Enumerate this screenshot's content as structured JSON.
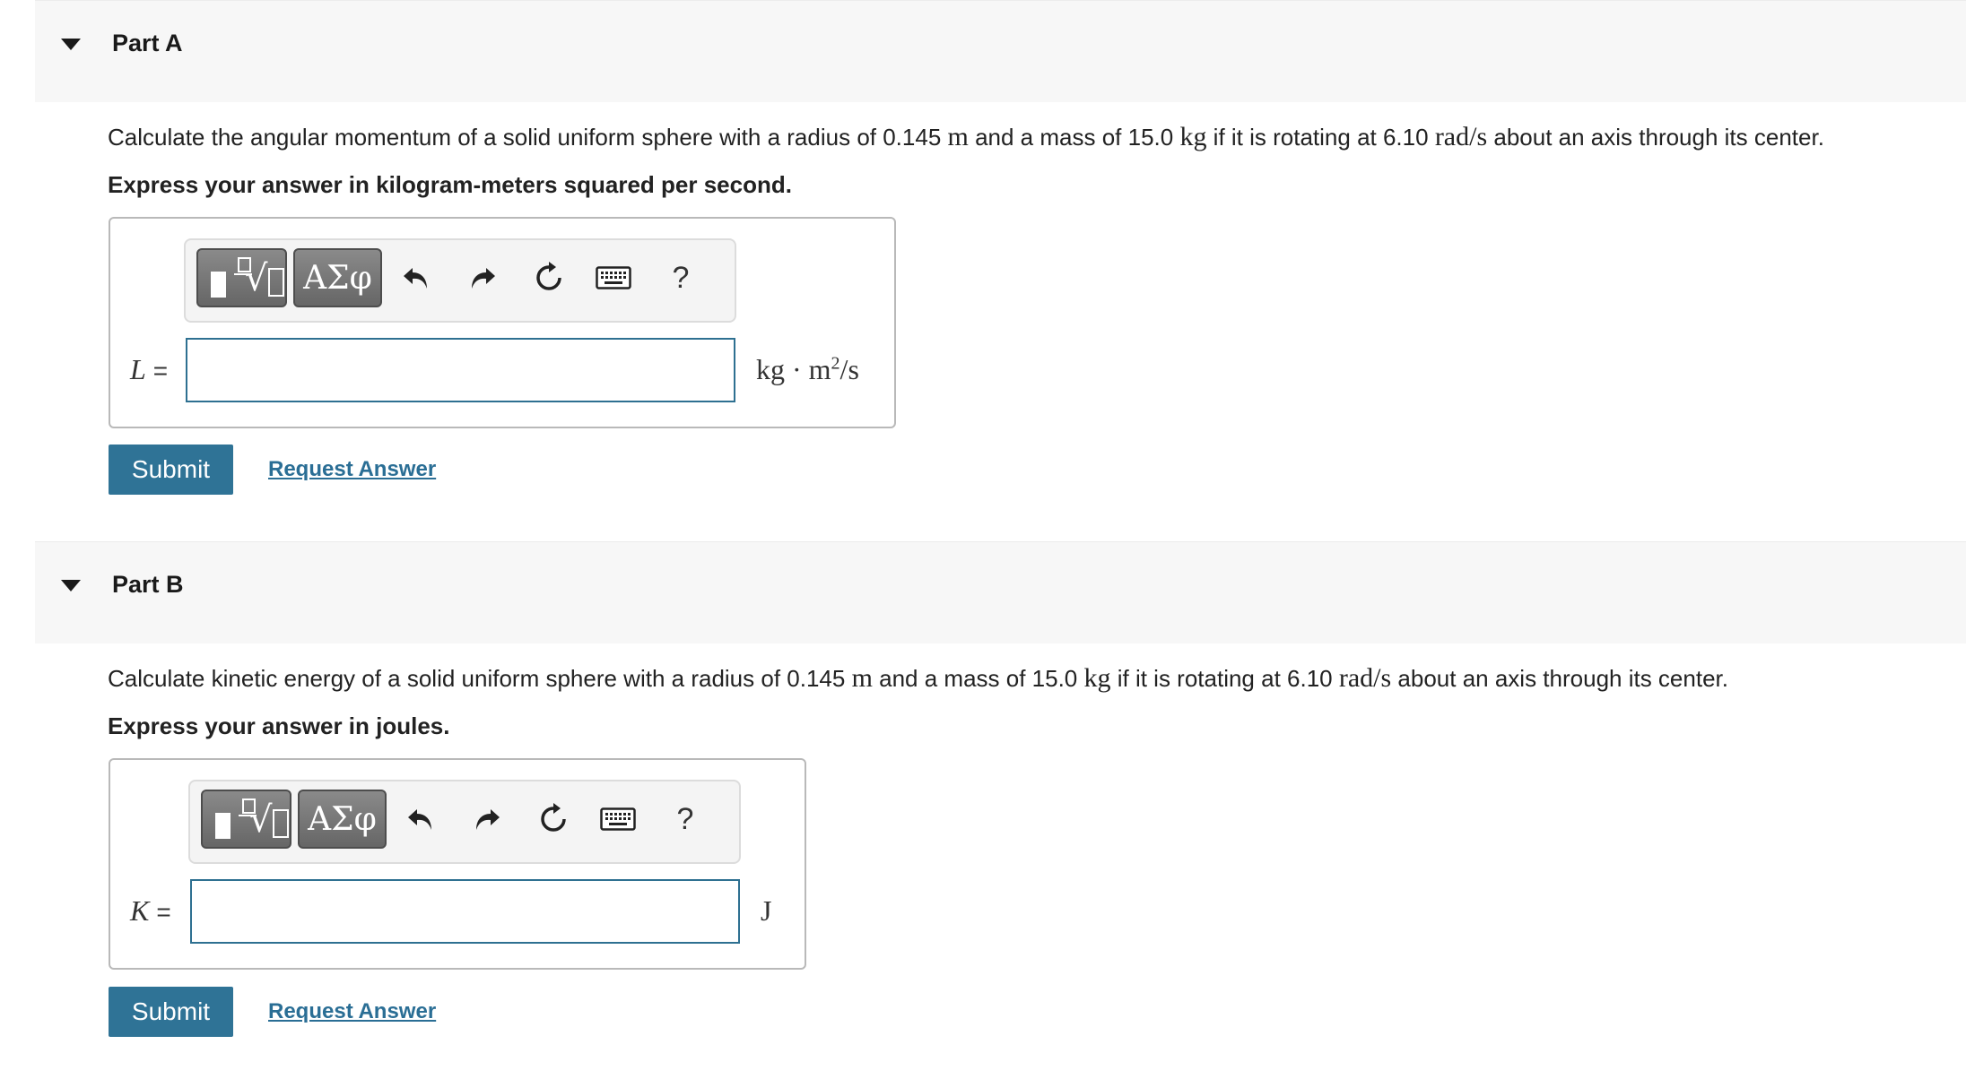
{
  "parts": [
    {
      "title": "Part A",
      "question": {
        "t1": "Calculate the angular momentum of a solid uniform sphere with a radius of 0.145 ",
        "u1": "m",
        "t2": " and a mass of 15.0 ",
        "u2": "kg",
        "t3": " if it is rotating at 6.10 ",
        "u3": "rad/s",
        "t4": " about an axis through its center."
      },
      "instruction": "Express your answer in kilogram-meters squared per second.",
      "variable": "L",
      "equals": "=",
      "answer_value": "",
      "unit_main": "kg · m",
      "unit_exp": "2",
      "unit_tail": "/s",
      "submit_label": "Submit",
      "request_label": "Request Answer"
    },
    {
      "title": "Part B",
      "question": {
        "t1": "Calculate kinetic energy of a solid uniform sphere with a radius of 0.145 ",
        "u1": "m",
        "t2": " and a mass of 15.0 ",
        "u2": "kg",
        "t3": " if it is rotating at 6.10 ",
        "u3": "rad/s",
        "t4": " about an axis through its center."
      },
      "instruction": "Express your answer in joules.",
      "variable": "K",
      "equals": "=",
      "answer_value": "",
      "unit_main": "J",
      "unit_exp": "",
      "unit_tail": "",
      "submit_label": "Submit",
      "request_label": "Request Answer"
    }
  ],
  "toolbar": {
    "greek_label": "ΑΣφ",
    "help_label": "?",
    "icons": [
      "templates-icon",
      "greek-letters-icon",
      "undo-icon",
      "redo-icon",
      "reset-icon",
      "keyboard-icon",
      "help-icon"
    ]
  },
  "colors": {
    "primary": "#2f7396",
    "link": "#2a6e95",
    "header_bg": "#f7f7f7",
    "input_border": "#2e7091"
  }
}
